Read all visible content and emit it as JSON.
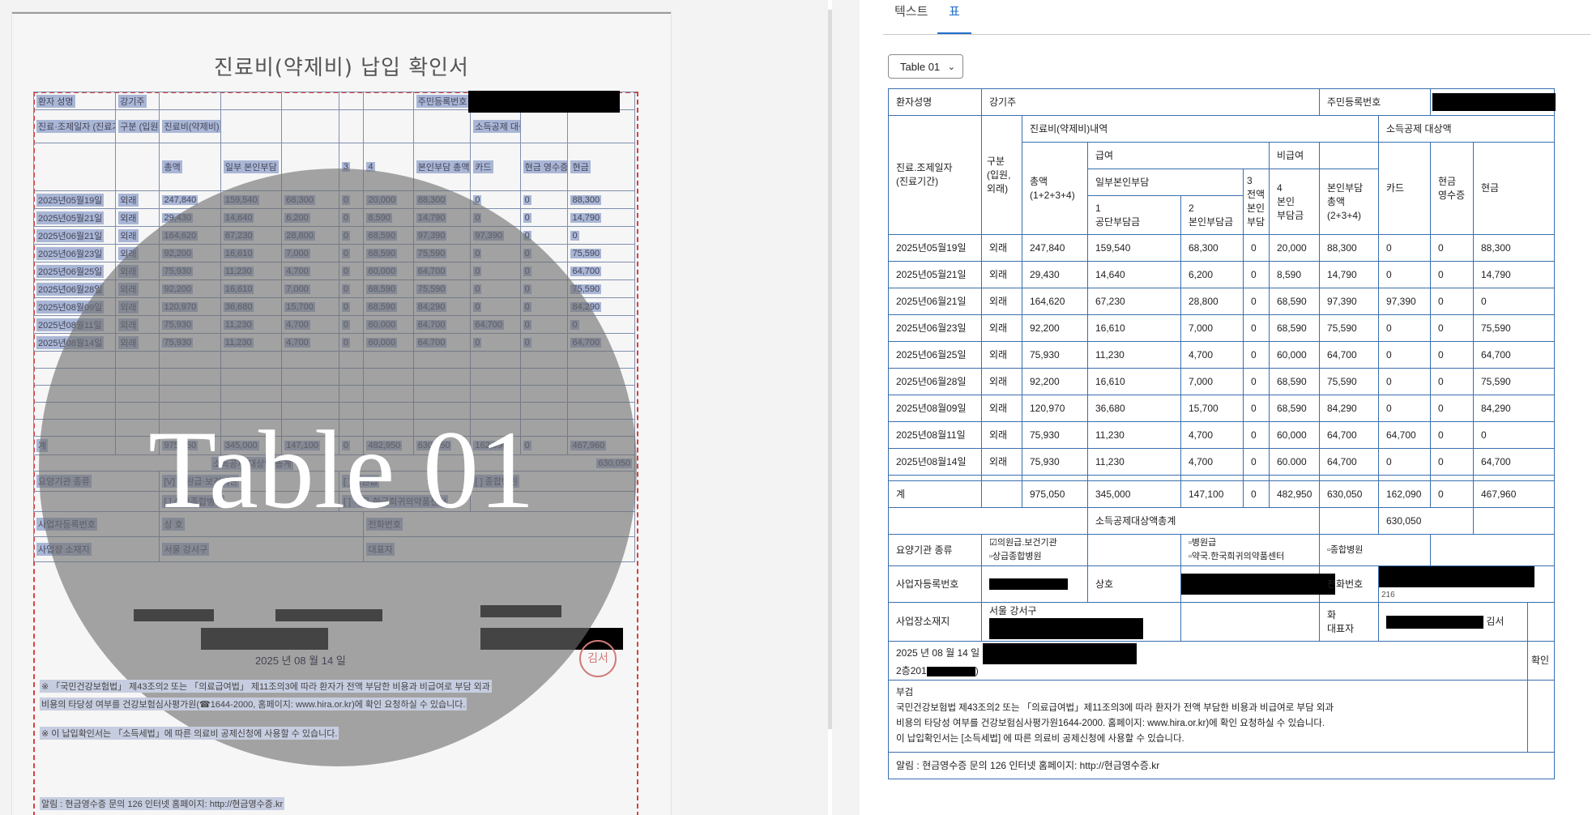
{
  "tabs": [
    {
      "label": "텍스트",
      "active": false
    },
    {
      "label": "표",
      "active": true
    }
  ],
  "table_selector": {
    "value": "Table 01"
  },
  "document": {
    "title": "진료비(약제비) 납입 확인서",
    "overlay_label": "Table 01",
    "date_line": "2025 년 08 월 14 일",
    "stamp": "김서",
    "scan_rows": [
      [
        "환자 성명",
        "강기주",
        "",
        "",
        "",
        "",
        "",
        "주민등록번호",
        "",
        "",
        ""
      ],
      [
        "진료·조제일자 (진료기간)",
        "구분 (입원, 외래)",
        "진료비(약제비) 내역",
        "",
        "",
        "",
        "",
        "",
        "소득공제 대상액",
        "",
        ""
      ],
      [
        "",
        "",
        "총액",
        "일부 본인부담",
        "",
        "3",
        "4",
        "본인부담 총액",
        "카드",
        "현금 영수증",
        "현금"
      ],
      [
        "2025년05월19일",
        "외래",
        "247,840",
        "159,540",
        "68,300",
        "0",
        "20,000",
        "88,300",
        "0",
        "0",
        "88,300"
      ],
      [
        "2025년05월21일",
        "외래",
        "29,430",
        "14,640",
        "6,200",
        "0",
        "8,590",
        "14,790",
        "0",
        "0",
        "14,790"
      ],
      [
        "2025년06월21일",
        "외래",
        "164,620",
        "67,230",
        "28,800",
        "0",
        "68,590",
        "97,390",
        "97,390",
        "0",
        "0"
      ],
      [
        "2025년06월23일",
        "외래",
        "92,200",
        "16,610",
        "7,000",
        "0",
        "68,590",
        "75,590",
        "0",
        "0",
        "75,590"
      ],
      [
        "2025년06월25일",
        "외래",
        "75,930",
        "11,230",
        "4,700",
        "0",
        "60,000",
        "64,700",
        "0",
        "0",
        "64,700"
      ],
      [
        "2025년06월28일",
        "외래",
        "92,200",
        "16,610",
        "7,000",
        "0",
        "68,590",
        "75,590",
        "0",
        "0",
        "75,590"
      ],
      [
        "2025년08월09일",
        "외래",
        "120,970",
        "36,680",
        "15,700",
        "0",
        "68,590",
        "84,290",
        "0",
        "0",
        "84,290"
      ],
      [
        "2025년08월11일",
        "외래",
        "75,930",
        "11,230",
        "4,700",
        "0",
        "60,000",
        "64,700",
        "64,700",
        "0",
        "0"
      ],
      [
        "2025년08월14일",
        "외래",
        "75,930",
        "11,230",
        "4,700",
        "0",
        "60,000",
        "64,700",
        "0",
        "0",
        "64,700"
      ]
    ],
    "total_row": [
      "계",
      "",
      "975,050",
      "345,000",
      "147,100",
      "0",
      "482,950",
      "630,050",
      "162,090",
      "0",
      "467,960"
    ],
    "deduction_label": "소득공제 대상액 총계",
    "deduction_value": "630,050",
    "facility_row": [
      "요양기관 종류",
      "[V] 의원급·보건기관",
      "[ ] 병원급",
      "[ ] 종합병원"
    ],
    "facility_row2": [
      "",
      "[ ] 상급종합병원",
      "[ ] 약국·한국희귀의약품센터",
      ""
    ],
    "business_row": [
      "사업자등록번호",
      "상 호",
      "전화번호"
    ],
    "address_row": [
      "사업장 소재지",
      "서울 강서구",
      "대표자"
    ],
    "foot1": "※ 「국민건강보험법」 제43조의2 또는 「의료급여법」 제11조의3에 따라 환자가 전액 부담한 비용과 비급여로 부담 외과",
    "foot2": "비용의 타당성 여부를 건강보험심사평가원(☎1644-2000, 홈페이지: www.hira.or.kr)에 확인 요청하실 수 있습니다.",
    "foot3": "※ 이 납입확인서는 「소득세법」에 따른 의료비 공제신청에 사용할 수 있습니다.",
    "foot4": "알림 : 현금영수증 문의 126 인터넷 홈페이지: http://현금영수증.kr"
  },
  "table": {
    "patient_label": "환자성명",
    "patient_name": "강기주",
    "rrn_label": "주민등록번호",
    "date_header": "진료.조제일자\n(진료기간)",
    "type_header": "구분\n(입원,\n외래)",
    "cost_header": "진료비(약제비)내역",
    "deduction_header": "소득공제 대상액",
    "covered_header": "급여",
    "noncovered_header": "비급여",
    "total_header": "총액\n(1+2+3+4)",
    "partial_header": "일부본인부담",
    "full_header": "3\n전액\n본인\n부담",
    "self_header": "4\n본인\n부담금",
    "self_total_header": "본인부담\n총액\n(2+3+4)",
    "card_header": "카드",
    "receipt_header": "현금\n영수증",
    "cash_header": "현금",
    "public_header": "1\n공단부담금",
    "own_header": "2\n본인부담금",
    "rows": [
      [
        "2025년05월19일",
        "외래",
        "247,840",
        "159,540",
        "68,300",
        "0",
        "20,000",
        "88,300",
        "0",
        "0",
        "88,300"
      ],
      [
        "2025년05월21일",
        "외래",
        "29,430",
        "14,640",
        "6,200",
        "0",
        "8,590",
        "14,790",
        "0",
        "0",
        "14,790"
      ],
      [
        "2025년06월21일",
        "외래",
        "164,620",
        "67,230",
        "28,800",
        "0",
        "68,590",
        "97,390",
        "97,390",
        "0",
        "0"
      ],
      [
        "2025년06월23일",
        "외래",
        "92,200",
        "16,610",
        "7,000",
        "0",
        "68,590",
        "75,590",
        "0",
        "0",
        "75,590"
      ],
      [
        "2025년06월25일",
        "외래",
        "75,930",
        "11,230",
        "4,700",
        "0",
        "60,000",
        "64,700",
        "0",
        "0",
        "64,700"
      ],
      [
        "2025년06월28일",
        "외래",
        "92,200",
        "16,610",
        "7,000",
        "0",
        "68,590",
        "75,590",
        "0",
        "0",
        "75,590"
      ],
      [
        "2025년08월09일",
        "외래",
        "120,970",
        "36,680",
        "15,700",
        "0",
        "68,590",
        "84,290",
        "0",
        "0",
        "84,290"
      ],
      [
        "2025년08월11일",
        "외래",
        "75,930",
        "11,230",
        "4,700",
        "0",
        "60,000",
        "64,700",
        "64,700",
        "0",
        "0"
      ],
      [
        "2025년08월14일",
        "외래",
        "75,930",
        "11,230",
        "4,700",
        "0",
        "60.000",
        "64,700",
        "0",
        "0",
        "64,700"
      ]
    ],
    "total": [
      "계",
      "",
      "975,050",
      "345,000",
      "147,100",
      "0",
      "482,950",
      "630,050",
      "162,090",
      "0",
      "467,960"
    ],
    "deduction_total_label": "소득공제대상액총계",
    "deduction_total_value": "630,050",
    "facility_label": "요양기관 종류",
    "facility_opt1": "☑의원급.보건기관\n▫상급종합병원",
    "facility_opt2": "▫병원급\n▫약국.한국희귀의약품센터",
    "facility_opt3": "▫종합병원",
    "bizno_label": "사업자등록번호",
    "shop_label": "상호",
    "phone_label": "전화번호",
    "phone_fragment": "216",
    "address_label": "사업장소재지",
    "address_value": "서울 강서구",
    "rep_label": "화\n대표자",
    "rep_value": "김서",
    "date_value": "2025 년 08 월 14 일",
    "date_line2a": "2층201",
    "date_line2b": ")",
    "confirm_label": "확인",
    "notes": "부검\n국민건강보험법 제43조의2 또는 「의료급여법」제11조의3에 따라 환자가 전액 부담한 비용과 비급여로 부담 외과\n비용의 타당성 여부를 건강보험심사평가원1644-2000. 홈페이지: www.hira.or.kr)에 확인 요청하실 수 있습니다.\n이 납입확인서는 [소득세법] 에 따른 의료비 공제신청에 사용할 수 있습니다.",
    "footer": "알림 : 현금영수증 문의 126 인터넷 홈페이지: http://현금영수증.kr"
  }
}
